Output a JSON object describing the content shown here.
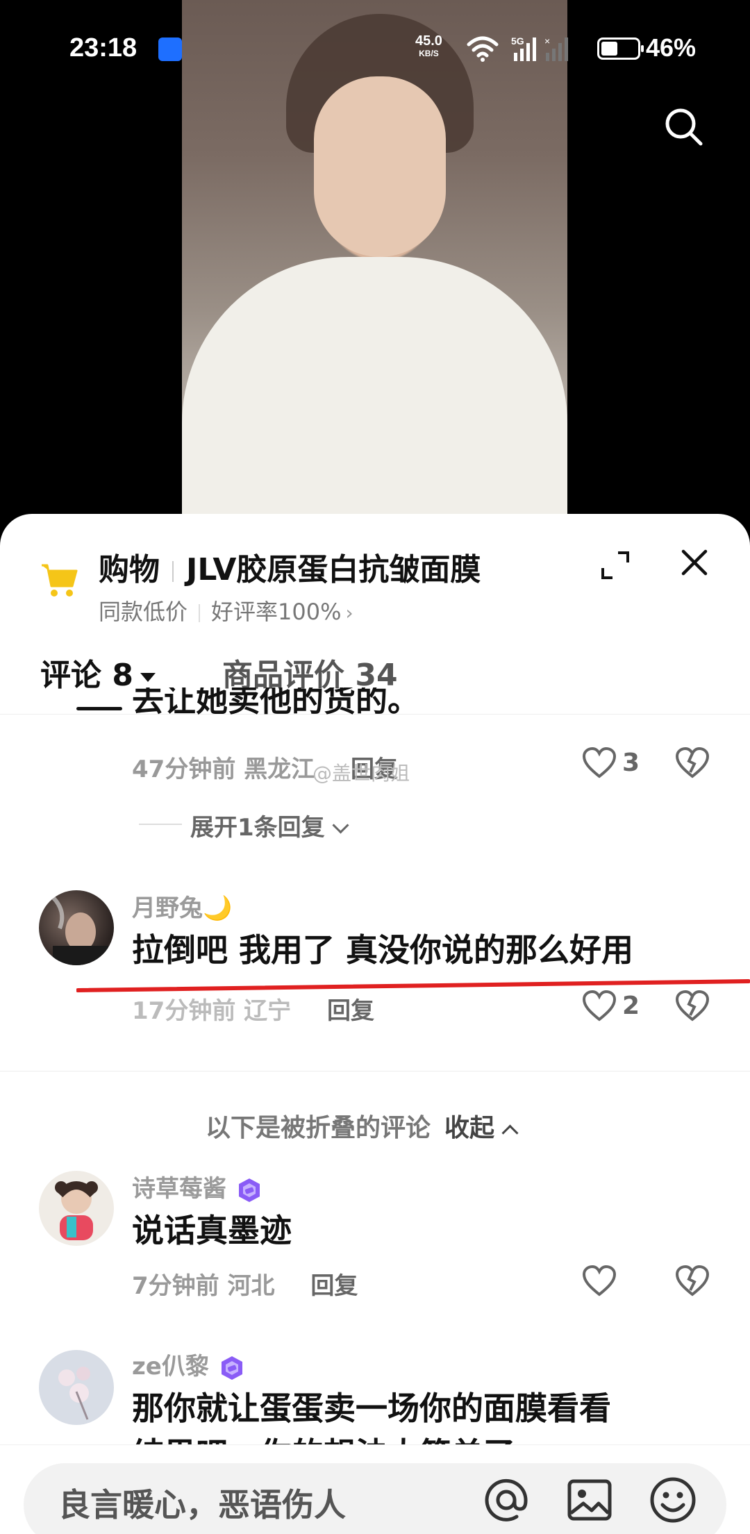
{
  "status": {
    "time": "23:18",
    "net_speed": "45.0",
    "net_unit": "KB/S",
    "network": "5G",
    "battery_level": 0.46,
    "battery_text": "46%"
  },
  "shop": {
    "label": "购物",
    "product": "JLV胶原蛋白抗皱面膜",
    "tag1": "同款低价",
    "tag2": "好评率100%"
  },
  "tabs": {
    "comments_label": "评论",
    "comments_count": "8",
    "reviews_label": "商品评价",
    "reviews_count": "34"
  },
  "comments": {
    "first": {
      "text_clipped": "去让她卖他的货的。",
      "time": "47分钟前",
      "location": "黑龙江",
      "reply": "回复",
      "likes": "3",
      "watermark": "@盖世肉姐",
      "expand": "展开1条回复"
    },
    "second": {
      "user": "月野兔",
      "user_emoji": "🌙",
      "text": "拉倒吧 我用了 真没你说的那么好用",
      "time": "17分钟前",
      "location": "辽宁",
      "reply": "回复",
      "likes": "2"
    },
    "folded_hint": "以下是被折叠的评论",
    "collapse": "收起",
    "third": {
      "user": "诗草莓酱",
      "text": "说话真墨迹",
      "time": "7分钟前",
      "location": "河北",
      "reply": "回复"
    },
    "fourth": {
      "user": "ze仈黎",
      "text_line1": "那你就让蛋蛋卖一场你的面膜看看",
      "text_line2": "结果吧，你的想法太简单了"
    }
  },
  "input": {
    "placeholder": "良言暖心，恶语伤人"
  },
  "colors": {
    "accent_cart": "#f5c518",
    "badge_purple": "#8a5cf6",
    "red_underline": "#e02020"
  }
}
